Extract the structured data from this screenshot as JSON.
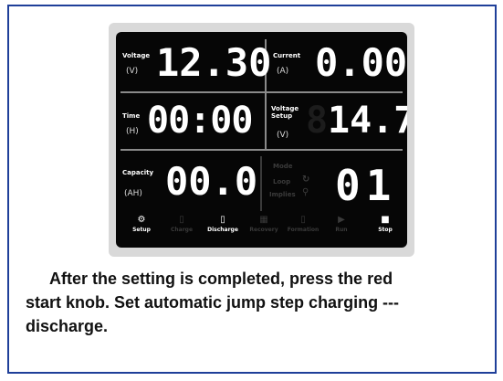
{
  "display": {
    "voltage": {
      "label": "Voltage",
      "unit": "(V)",
      "value": "12.30"
    },
    "current": {
      "label": "Current",
      "unit": "(A)",
      "value": "0.00"
    },
    "time": {
      "label": "Time",
      "unit": "(H)",
      "value": "00:00"
    },
    "voltage_setup": {
      "label": "Voltage Setup",
      "unit": "(V)",
      "value": "14.7"
    },
    "capacity": {
      "label": "Capacity",
      "unit": "(AH)",
      "value": "00.0"
    },
    "mode_list": [
      "Mode",
      "Loop",
      "Implies"
    ],
    "step": "01"
  },
  "buttons": [
    {
      "label": "Setup",
      "icon": "gear-icon",
      "active": true
    },
    {
      "label": "Charge",
      "icon": "battery-charge-icon",
      "active": false
    },
    {
      "label": "Discharge",
      "icon": "battery-discharge-icon",
      "active": true
    },
    {
      "label": "Recovery",
      "icon": "recovery-icon",
      "active": false
    },
    {
      "label": "Formation",
      "icon": "formation-icon",
      "active": false
    },
    {
      "label": "Run",
      "icon": "play-icon",
      "active": false
    },
    {
      "label": "Stop",
      "icon": "stop-icon",
      "active": true
    }
  ],
  "caption": {
    "line1": "After the setting is completed, press the red",
    "line2": "start knob. Set automatic jump step charging ---",
    "line3": "discharge."
  },
  "colors": {
    "border": "#1f3f99",
    "screen": "#060606",
    "digits": "#ffffff"
  }
}
